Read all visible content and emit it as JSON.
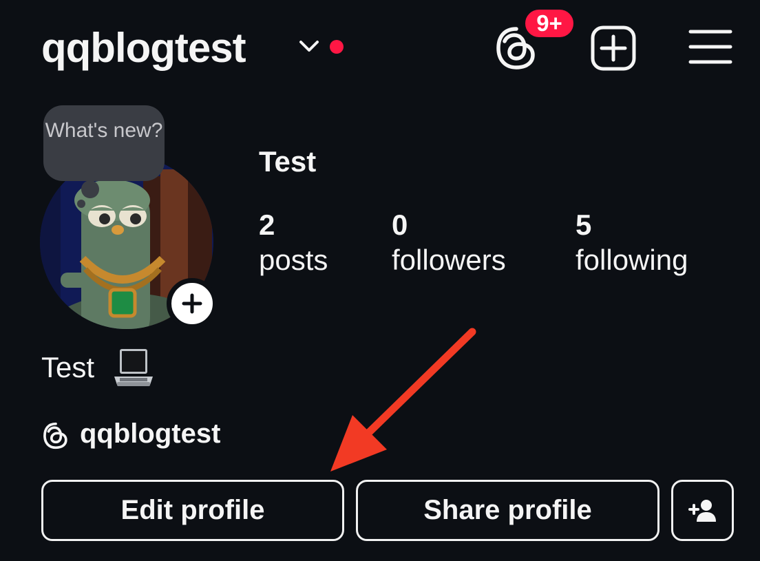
{
  "header": {
    "username": "qqblogtest",
    "threads_badge": "9+",
    "icons": {
      "chevron": "chevron-down-icon",
      "threads": "threads-icon",
      "create": "plus-square-icon",
      "menu": "hamburger-menu-icon"
    }
  },
  "profile": {
    "note_text": "What's new?",
    "display_name": "Test",
    "stats": [
      {
        "count": "2",
        "label": "posts"
      },
      {
        "count": "0",
        "label": "followers"
      },
      {
        "count": "5",
        "label": "following"
      }
    ],
    "bio": "Test",
    "threads_handle": "qqblogtest"
  },
  "buttons": {
    "edit_profile": "Edit profile",
    "share_profile": "Share profile"
  },
  "colors": {
    "background": "#0c0f14",
    "accent_red": "#ff1744",
    "annotation_arrow": "#f23a24"
  }
}
